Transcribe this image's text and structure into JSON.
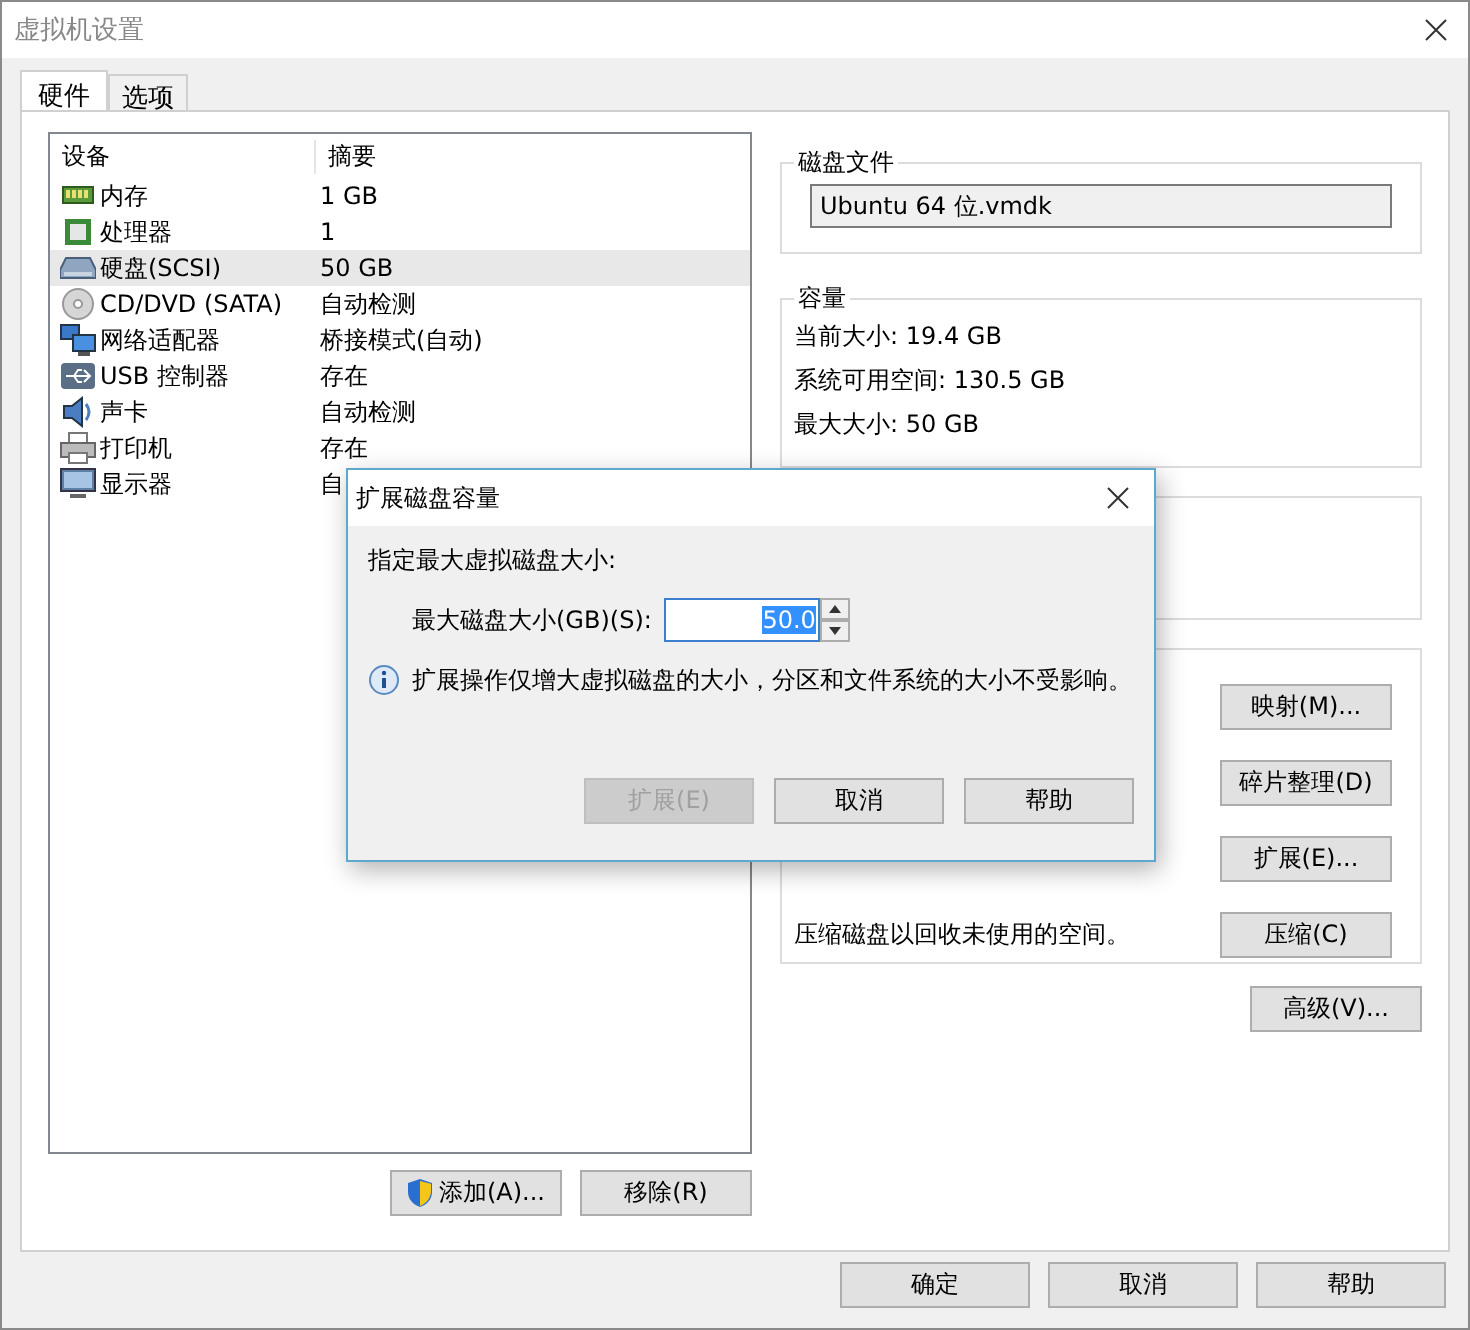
{
  "window": {
    "title": "虚拟机设置"
  },
  "tabs": [
    {
      "label": "硬件",
      "selected": true
    },
    {
      "label": "选项",
      "selected": false
    }
  ],
  "device_list": {
    "columns": [
      "设备",
      "摘要"
    ],
    "rows": [
      {
        "kind": "memory",
        "device": "内存",
        "summary": "1 GB",
        "selected": false
      },
      {
        "kind": "processor",
        "device": "处理器",
        "summary": "1",
        "selected": false
      },
      {
        "kind": "disk",
        "device": "硬盘(SCSI)",
        "summary": "50 GB",
        "selected": true
      },
      {
        "kind": "cd",
        "device": "CD/DVD (SATA)",
        "summary": "自动检测",
        "selected": false
      },
      {
        "kind": "network",
        "device": "网络适配器",
        "summary": "桥接模式(自动)",
        "selected": false
      },
      {
        "kind": "usb",
        "device": "USB 控制器",
        "summary": "存在",
        "selected": false
      },
      {
        "kind": "sound",
        "device": "声卡",
        "summary": "自动检测",
        "selected": false
      },
      {
        "kind": "printer",
        "device": "打印机",
        "summary": "存在",
        "selected": false
      },
      {
        "kind": "display",
        "device": "显示器",
        "summary": "自",
        "selected": false
      }
    ]
  },
  "list_buttons": [
    {
      "label": "添加(A)...",
      "shield": true
    },
    {
      "label": "移除(R)",
      "shield": false
    }
  ],
  "disk_file": {
    "title": "磁盘文件",
    "value": "Ubuntu 64 位.vmdk"
  },
  "capacity": {
    "title": "容量",
    "lines": [
      "当前大小: 19.4 GB",
      "系统可用空间: 130.5 GB",
      "最大大小: 50 GB"
    ]
  },
  "utilities": {
    "rows": [
      {
        "button": "映射(M)..."
      },
      {
        "button": "碎片整理(D)"
      },
      {
        "button": "扩展(E)..."
      },
      {
        "text": "压缩磁盘以回收未使用的空间。",
        "button": "压缩(C)"
      }
    ]
  },
  "advanced_button": "高级(V)...",
  "footer_buttons": [
    "确定",
    "取消",
    "帮助"
  ],
  "dialog": {
    "title": "扩展磁盘容量",
    "prompt": "指定最大虚拟磁盘大小:",
    "field_label": "最大磁盘大小(GB)(S):",
    "value": "50.0",
    "value_selected": true,
    "info": "扩展操作仅增大虚拟磁盘的大小，分区和文件系统的大小不受影响。",
    "buttons": [
      {
        "label": "扩展(E)",
        "disabled": true
      },
      {
        "label": "取消",
        "disabled": false
      },
      {
        "label": "帮助",
        "disabled": false
      }
    ]
  }
}
